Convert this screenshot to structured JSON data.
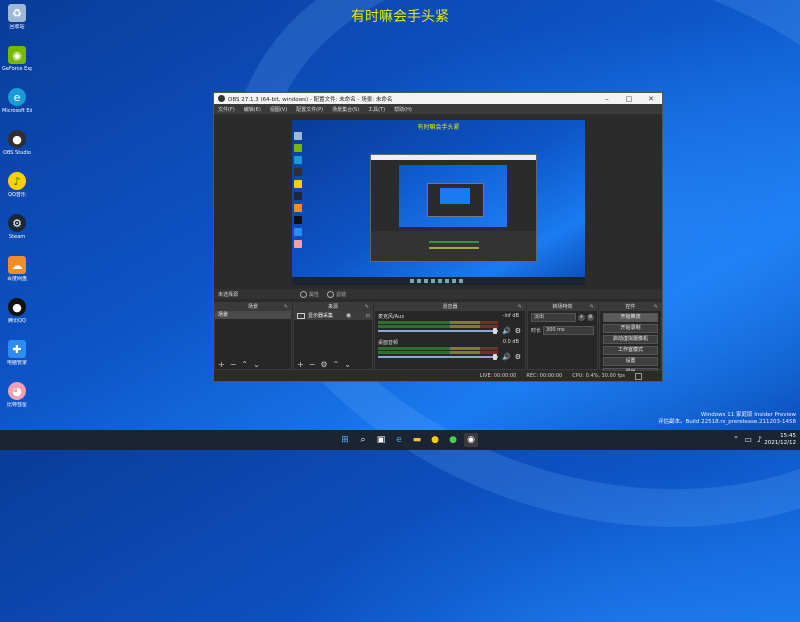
{
  "banner": "有时嘛会手头紧",
  "desktop_icons": [
    {
      "label": "回收站",
      "icon": "recycle-bin-icon",
      "color": "#9fb7d8"
    },
    {
      "label": "GeForce Experience",
      "icon": "nvidia-icon",
      "color": "#76b900"
    },
    {
      "label": "Microsoft Edge",
      "icon": "edge-icon",
      "color": "#1a9bd7"
    },
    {
      "label": "OBS Studio",
      "icon": "obs-icon",
      "color": "#302e31"
    },
    {
      "label": "QQ音乐",
      "icon": "qq-music-icon",
      "color": "#ffd000"
    },
    {
      "label": "Steam",
      "icon": "steam-icon",
      "color": "#1b2838"
    },
    {
      "label": "百度网盘",
      "icon": "baidu-netdisk-icon",
      "color": "#f28c28"
    },
    {
      "label": "腾讯QQ",
      "icon": "qq-icon",
      "color": "#111111"
    },
    {
      "label": "电脑管家",
      "icon": "pc-manager-icon",
      "color": "#2d8cf0"
    },
    {
      "label": "比特彗星",
      "icon": "pig-icon",
      "color": "#f0a0b0"
    }
  ],
  "obs": {
    "title": "OBS 27.1.3 (64-bit, windows) - 配置文件: 未命名 - 场景: 未命名",
    "menu": [
      "文件(F)",
      "编辑(E)",
      "视图(V)",
      "配置文件(P)",
      "场景集合(S)",
      "工具(T)",
      "帮助(H)"
    ],
    "preview_banner": "有时嘛会手头紧",
    "scene_label": "未选择源",
    "toggles": [
      "属性",
      "滤镜"
    ],
    "docks": {
      "scenes": {
        "title": "场景",
        "items": [
          "场景"
        ]
      },
      "sources": {
        "title": "来源",
        "items": [
          "显示器采集"
        ]
      },
      "mixer": {
        "title": "混音器",
        "channels": [
          {
            "name": "麦克风/Aux",
            "db": "-inf dB"
          },
          {
            "name": "桌面音频",
            "db": "0.0 dB"
          }
        ]
      },
      "transitions": {
        "title": "转场特效",
        "type": "淡出",
        "duration_label": "时长",
        "duration": "300 ms"
      },
      "controls": {
        "title": "控件",
        "buttons": [
          "开始推流",
          "开始录制",
          "启动虚拟摄像机",
          "工作室模式",
          "设置",
          "退出"
        ]
      }
    },
    "status": {
      "live": "LIVE: 00:00:00",
      "rec": "REC: 00:00:00",
      "cpu": "CPU: 0.4%, 30.00 fps"
    }
  },
  "watermark": {
    "line1": "Windows 11 家庭版 Insider Preview",
    "line2": "评估副本。Build 22518.rs_prerelease.211203-1458"
  },
  "clock": {
    "time": "15:45",
    "date": "2021/12/12"
  },
  "colors": {
    "accent": "#1a7bf0",
    "banner": "#e8e800",
    "obs_bg": "#2b2b2b"
  }
}
